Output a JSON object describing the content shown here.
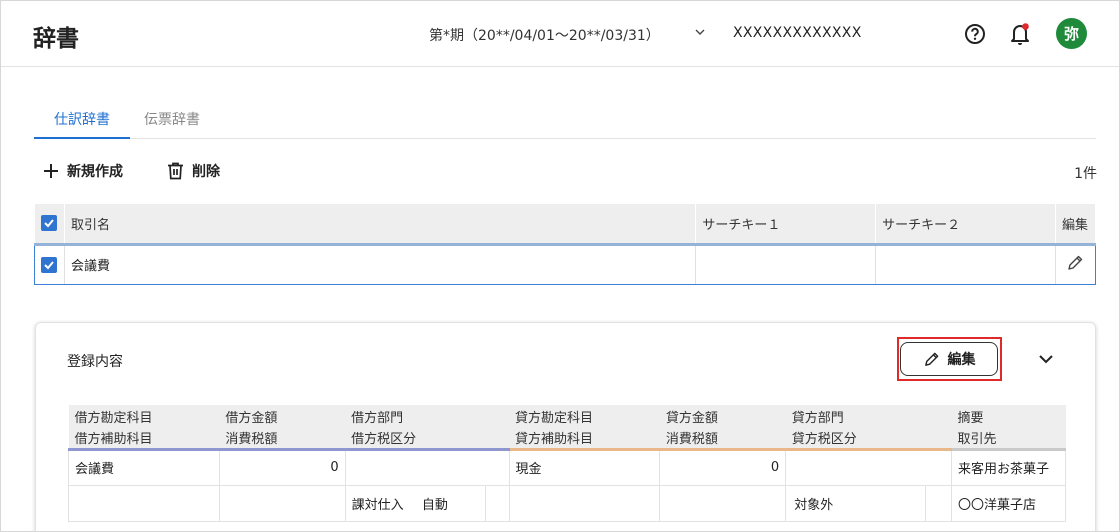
{
  "header": {
    "title": "辞書",
    "period": "第*期（20**/04/01〜20**/03/31）",
    "company": "XXXXXXXXXXXXX",
    "avatar": "弥",
    "notify_color": "#e02a2a",
    "avatar_color": "#1e8a3a"
  },
  "tabs": [
    {
      "label": "仕訳辞書",
      "active": true
    },
    {
      "label": "伝票辞書",
      "active": false
    }
  ],
  "toolbar": {
    "new_label": "新規作成",
    "delete_label": "削除",
    "count": "1件"
  },
  "list": {
    "headers": [
      "取引名",
      "サーチキー１",
      "サーチキー２",
      "編集"
    ],
    "rows": [
      {
        "name": "会議費",
        "key1": "",
        "key2": "",
        "checked": true
      }
    ]
  },
  "detail": {
    "title": "登録内容",
    "edit_label": "編集",
    "headers_row1": [
      "借方勘定科目",
      "借方金額",
      "借方部門",
      "貸方勘定科目",
      "貸方金額",
      "貸方部門",
      "摘要"
    ],
    "headers_row2": [
      "借方補助科目",
      "消費税額",
      "借方税区分",
      "貸方補助科目",
      "消費税額",
      "貸方税区分",
      "取引先"
    ],
    "row1": [
      "会議費",
      "0",
      "",
      "現金",
      "0",
      "",
      "来客用お茶菓子"
    ],
    "row2": {
      "debit_sub": "",
      "debit_tax_amount": "",
      "debit_tax_class": "課対仕入",
      "debit_tax_mode": "自動",
      "credit_sub": "",
      "credit_tax_amount": "",
      "credit_tax_class": "対象外",
      "partner": "〇〇洋菓子店"
    }
  }
}
